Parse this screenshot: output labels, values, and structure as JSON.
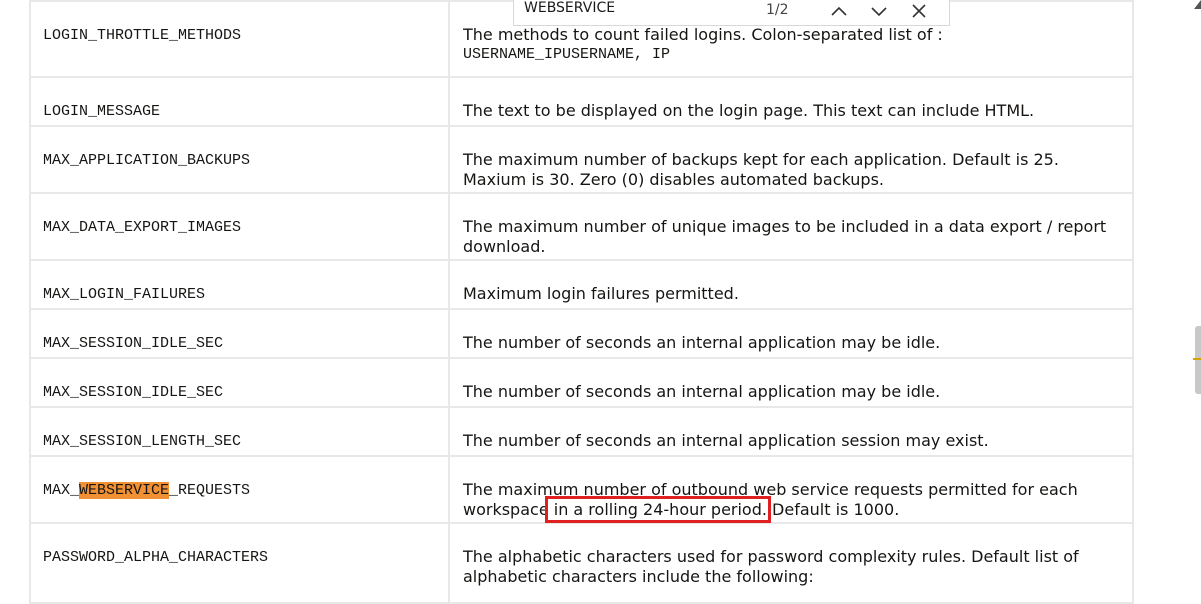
{
  "find_bar": {
    "query": "WEBSERVICE",
    "match_count": "1/2"
  },
  "rows": [
    {
      "name": "LOGIN_THROTTLE_METHODS",
      "desc_line1": "The methods to count failed logins. Colon-separated list of :",
      "desc_mono": "USERNAME_IPUSERNAME, IP"
    },
    {
      "name": "LOGIN_MESSAGE",
      "desc": "The text to be displayed on the login page. This text can include HTML."
    },
    {
      "name": "MAX_APPLICATION_BACKUPS",
      "desc": "The maximum number of backups kept for each application. Default is 25. Maxium is 30. Zero (0) disables automated backups."
    },
    {
      "name": "MAX_DATA_EXPORT_IMAGES",
      "desc": "The maximum number of unique images to be included in a data export / report download."
    },
    {
      "name": "MAX_LOGIN_FAILURES",
      "desc": "Maximum login failures permitted."
    },
    {
      "name": "MAX_SESSION_IDLE_SEC",
      "desc": "The number of seconds an internal application may be idle."
    },
    {
      "name": "MAX_SESSION_IDLE_SEC",
      "desc": "The number of seconds an internal application may be idle."
    },
    {
      "name": "MAX_SESSION_LENGTH_SEC",
      "desc": "The number of seconds an internal application session may exist."
    },
    {
      "name_prefix": "MAX_",
      "name_highlight": "WEBSERVICE",
      "name_suffix": "_REQUESTS",
      "desc_part1": "The maximum number of outbound web service requests permitted for each workspace",
      "desc_boxed": " in a rolling 24-hour period.",
      "desc_part2": " Default is 1000."
    },
    {
      "name": "PASSWORD_ALPHA_CHARACTERS",
      "desc": "The alphabetic characters used for password complexity rules. Default list of alphabetic characters include the following:"
    }
  ]
}
